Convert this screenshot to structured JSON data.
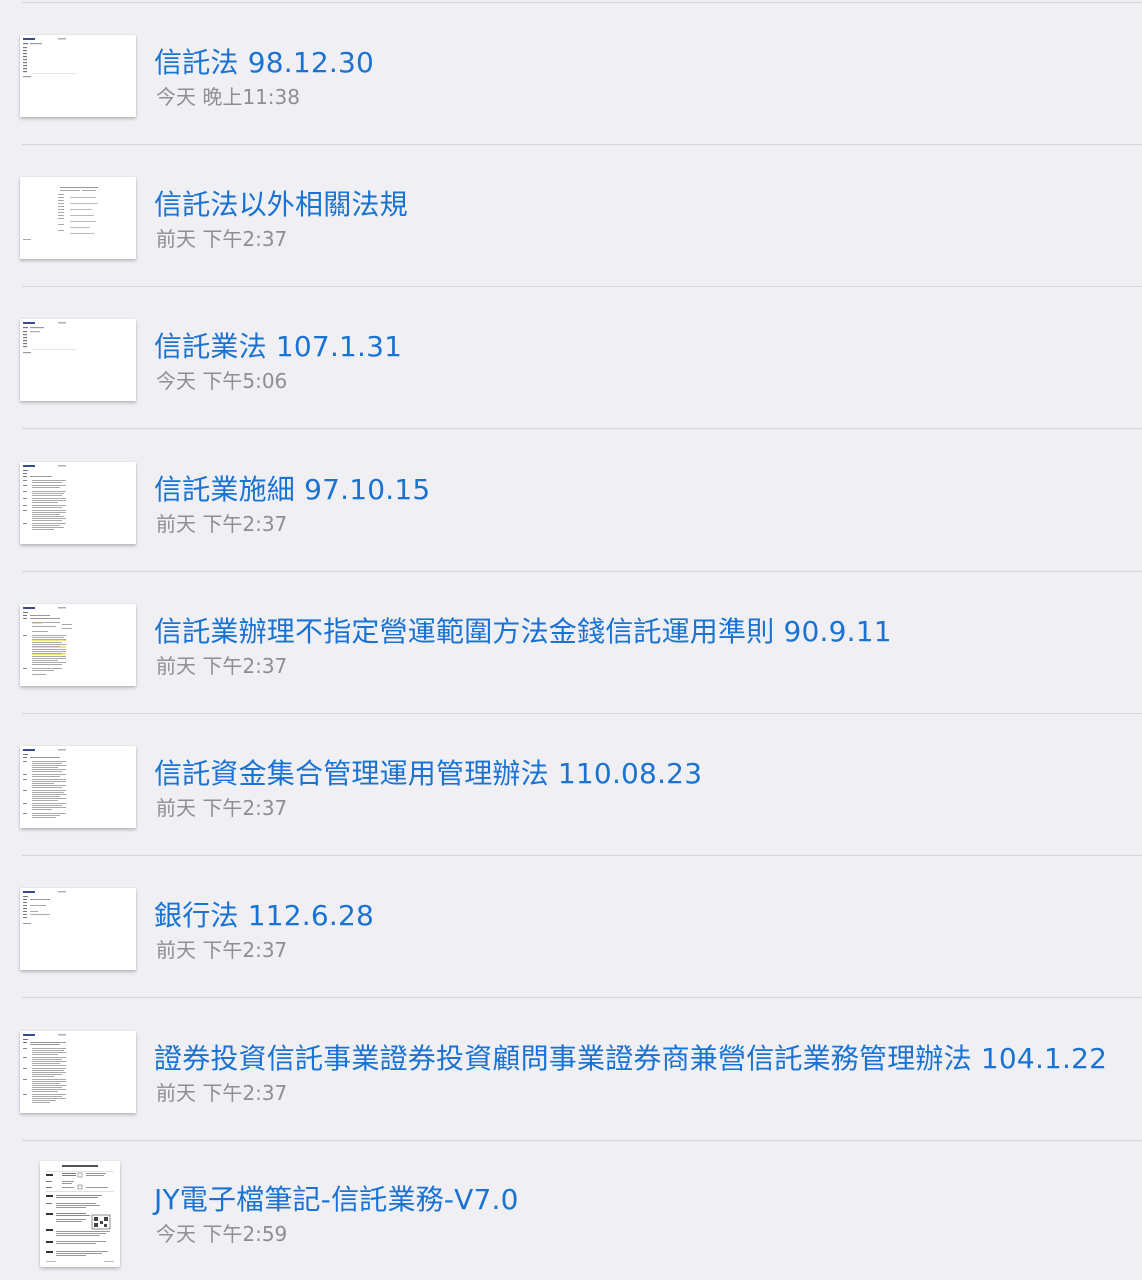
{
  "files": [
    {
      "title": "信託法 98.12.30",
      "date": "今天 晚上11:38",
      "thumbnail": "document-thumbnail-sparse"
    },
    {
      "title": "信託法以外相關法規",
      "date": "前天 下午2:37",
      "thumbnail": "document-thumbnail-centered"
    },
    {
      "title": "信託業法 107.1.31",
      "date": "今天 下午5:06",
      "thumbnail": "document-thumbnail-sparse"
    },
    {
      "title": "信託業施細 97.10.15",
      "date": "前天 下午2:37",
      "thumbnail": "document-thumbnail-dense"
    },
    {
      "title": "信託業辦理不指定營運範圍方法金錢信託運用準則 90.9.11",
      "date": "前天 下午2:37",
      "thumbnail": "document-thumbnail-highlighted"
    },
    {
      "title": "信託資金集合管理運用管理辦法 110.08.23",
      "date": "前天 下午2:37",
      "thumbnail": "document-thumbnail-dense"
    },
    {
      "title": "銀行法 112.6.28",
      "date": "前天 下午2:37",
      "thumbnail": "document-thumbnail-sparse"
    },
    {
      "title": "證券投資信託事業證券投資顧問事業證券商兼營信託業務管理辦法 104.1.22",
      "date": "前天 下午2:37",
      "thumbnail": "document-thumbnail-dense"
    },
    {
      "title": "JY電子檔筆記-信託業務-V7.0",
      "date": "今天 下午2:59",
      "thumbnail": "document-thumbnail-notes"
    }
  ],
  "colors": {
    "background": "#efeff4",
    "title": "#1a73d2",
    "date": "#8e8e93",
    "divider": "#d6d6db"
  }
}
